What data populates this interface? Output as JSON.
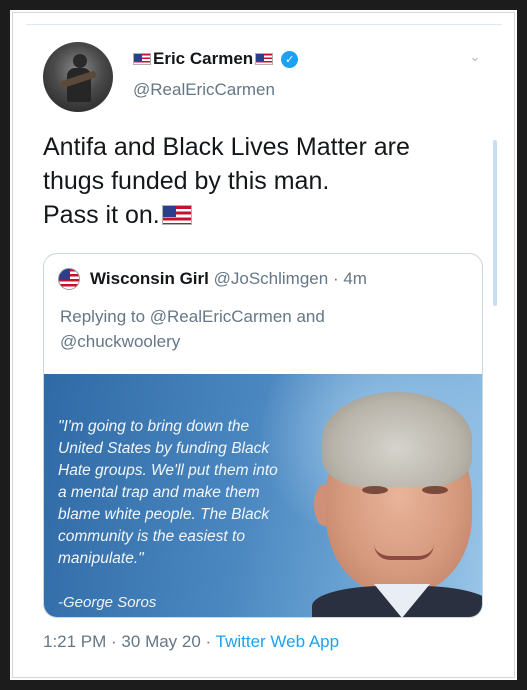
{
  "author": {
    "name": "Eric Carmen",
    "handle": "@RealEricCarmen",
    "verified": true
  },
  "tweet": {
    "lines": [
      "Antifa and Black Lives Matter are",
      "thugs funded by this man.",
      "Pass it on."
    ]
  },
  "quoted": {
    "name": "Wisconsin Girl",
    "handle": "@JoSchlimgen",
    "time": "· 4m",
    "reply_lines": [
      "Replying to @RealEricCarmen and",
      "@chuckwoolery"
    ],
    "image_quote_lines": [
      "\"I'm going to bring down the",
      "United States by funding Black",
      "Hate groups. We'll put them into",
      "a mental trap and make them",
      "blame white people. The Black",
      "community is the easiest to",
      "manipulate.\""
    ],
    "image_attribution": "-George Soros"
  },
  "meta": {
    "time": "1:21 PM",
    "date": "· 30 May 20 ·",
    "app": "Twitter Web App"
  },
  "colors": {
    "accent": "#1da1f2",
    "secondary_text": "#657786",
    "border": "#ccd6dd"
  },
  "icons": {
    "verified": "verified-badge-icon",
    "menu": "chevron-down-icon",
    "flag": "us-flag-icon"
  }
}
